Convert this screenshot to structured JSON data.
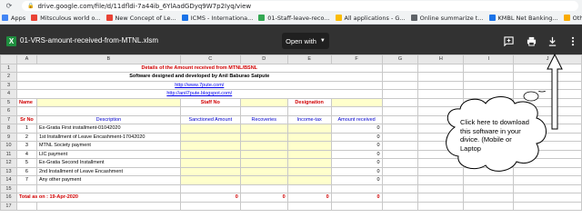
{
  "browser": {
    "url": "drive.google.com/file/d/11dfldi-7a44ib_6YlAadGDyq9W7p2Iyq/view",
    "bookmarks": [
      {
        "label": "Apps",
        "color": "#4285f4"
      },
      {
        "label": "Mitsculous world o...",
        "color": "#e94235"
      },
      {
        "label": "New Concept of Le...",
        "color": "#e94235"
      },
      {
        "label": "ICMS - Internationa...",
        "color": "#1a73e8"
      },
      {
        "label": "01-Staff-leave-reco...",
        "color": "#34a853"
      },
      {
        "label": "All applications - G...",
        "color": "#fbbc04"
      },
      {
        "label": "Online summarize t...",
        "color": "#5f6368"
      },
      {
        "label": "KMBL Net Banking...",
        "color": "#1a73e8"
      },
      {
        "label": "Othe",
        "color": "#f9ab00"
      }
    ]
  },
  "viewer": {
    "file_icon_letter": "X",
    "file_name": "01-VRS-amount-received-from-MTNL.xlsm",
    "open_with_label": "Open with",
    "tools": [
      "add-comment-icon",
      "print-icon",
      "download-icon",
      "more-icon"
    ]
  },
  "sheet": {
    "columns": [
      "",
      "A",
      "B",
      "C",
      "D",
      "E",
      "F",
      "G",
      "H",
      "I",
      "J"
    ],
    "row_numbers": [
      "1",
      "2",
      "3",
      "4",
      "5",
      "6",
      "7",
      "8",
      "9",
      "10",
      "11",
      "12",
      "13",
      "14",
      "15",
      "16",
      "17",
      "18"
    ],
    "title": "Details of the Amount received from MTNL/BSNL",
    "subtitle": "Software designed and developed by Anil Baburao Satpute",
    "link1": "http://www.7pute.com/",
    "link2": "http://anil7pute.blogspot.com/",
    "name_label": "Name",
    "staff_no_label": "Staff No",
    "designation_label": "Designation",
    "headers": {
      "sr_no": "Sr No",
      "description": "Description",
      "sanctioned": "Sanctioned Amount",
      "recoveries": "Recoveries",
      "income_tax": "Income-tax",
      "received": "Amount received"
    },
    "rows": [
      {
        "sr": "1",
        "desc": "Ex-Gratia First installment-01042020",
        "received": "0"
      },
      {
        "sr": "2",
        "desc": "1st Installment of Leave Encashment-17042020",
        "received": "0"
      },
      {
        "sr": "3",
        "desc": "MTNL Society payment",
        "received": "0"
      },
      {
        "sr": "4",
        "desc": "LIC payment",
        "received": "0"
      },
      {
        "sr": "5",
        "desc": "Ex-Gratia Second Installment",
        "received": "0"
      },
      {
        "sr": "6",
        "desc": "2nd Installment of Leave Encashment",
        "received": "0"
      },
      {
        "sr": "7",
        "desc": "Any other payment",
        "received": "0"
      }
    ],
    "total_label": "Total as on : 19-Apr-2020",
    "totals": {
      "sanctioned": "0",
      "recoveries": "0",
      "income_tax": "0",
      "received": "0"
    }
  },
  "callout": {
    "text": "Click here to download this software in your divice. (Mobile or Laptop"
  }
}
